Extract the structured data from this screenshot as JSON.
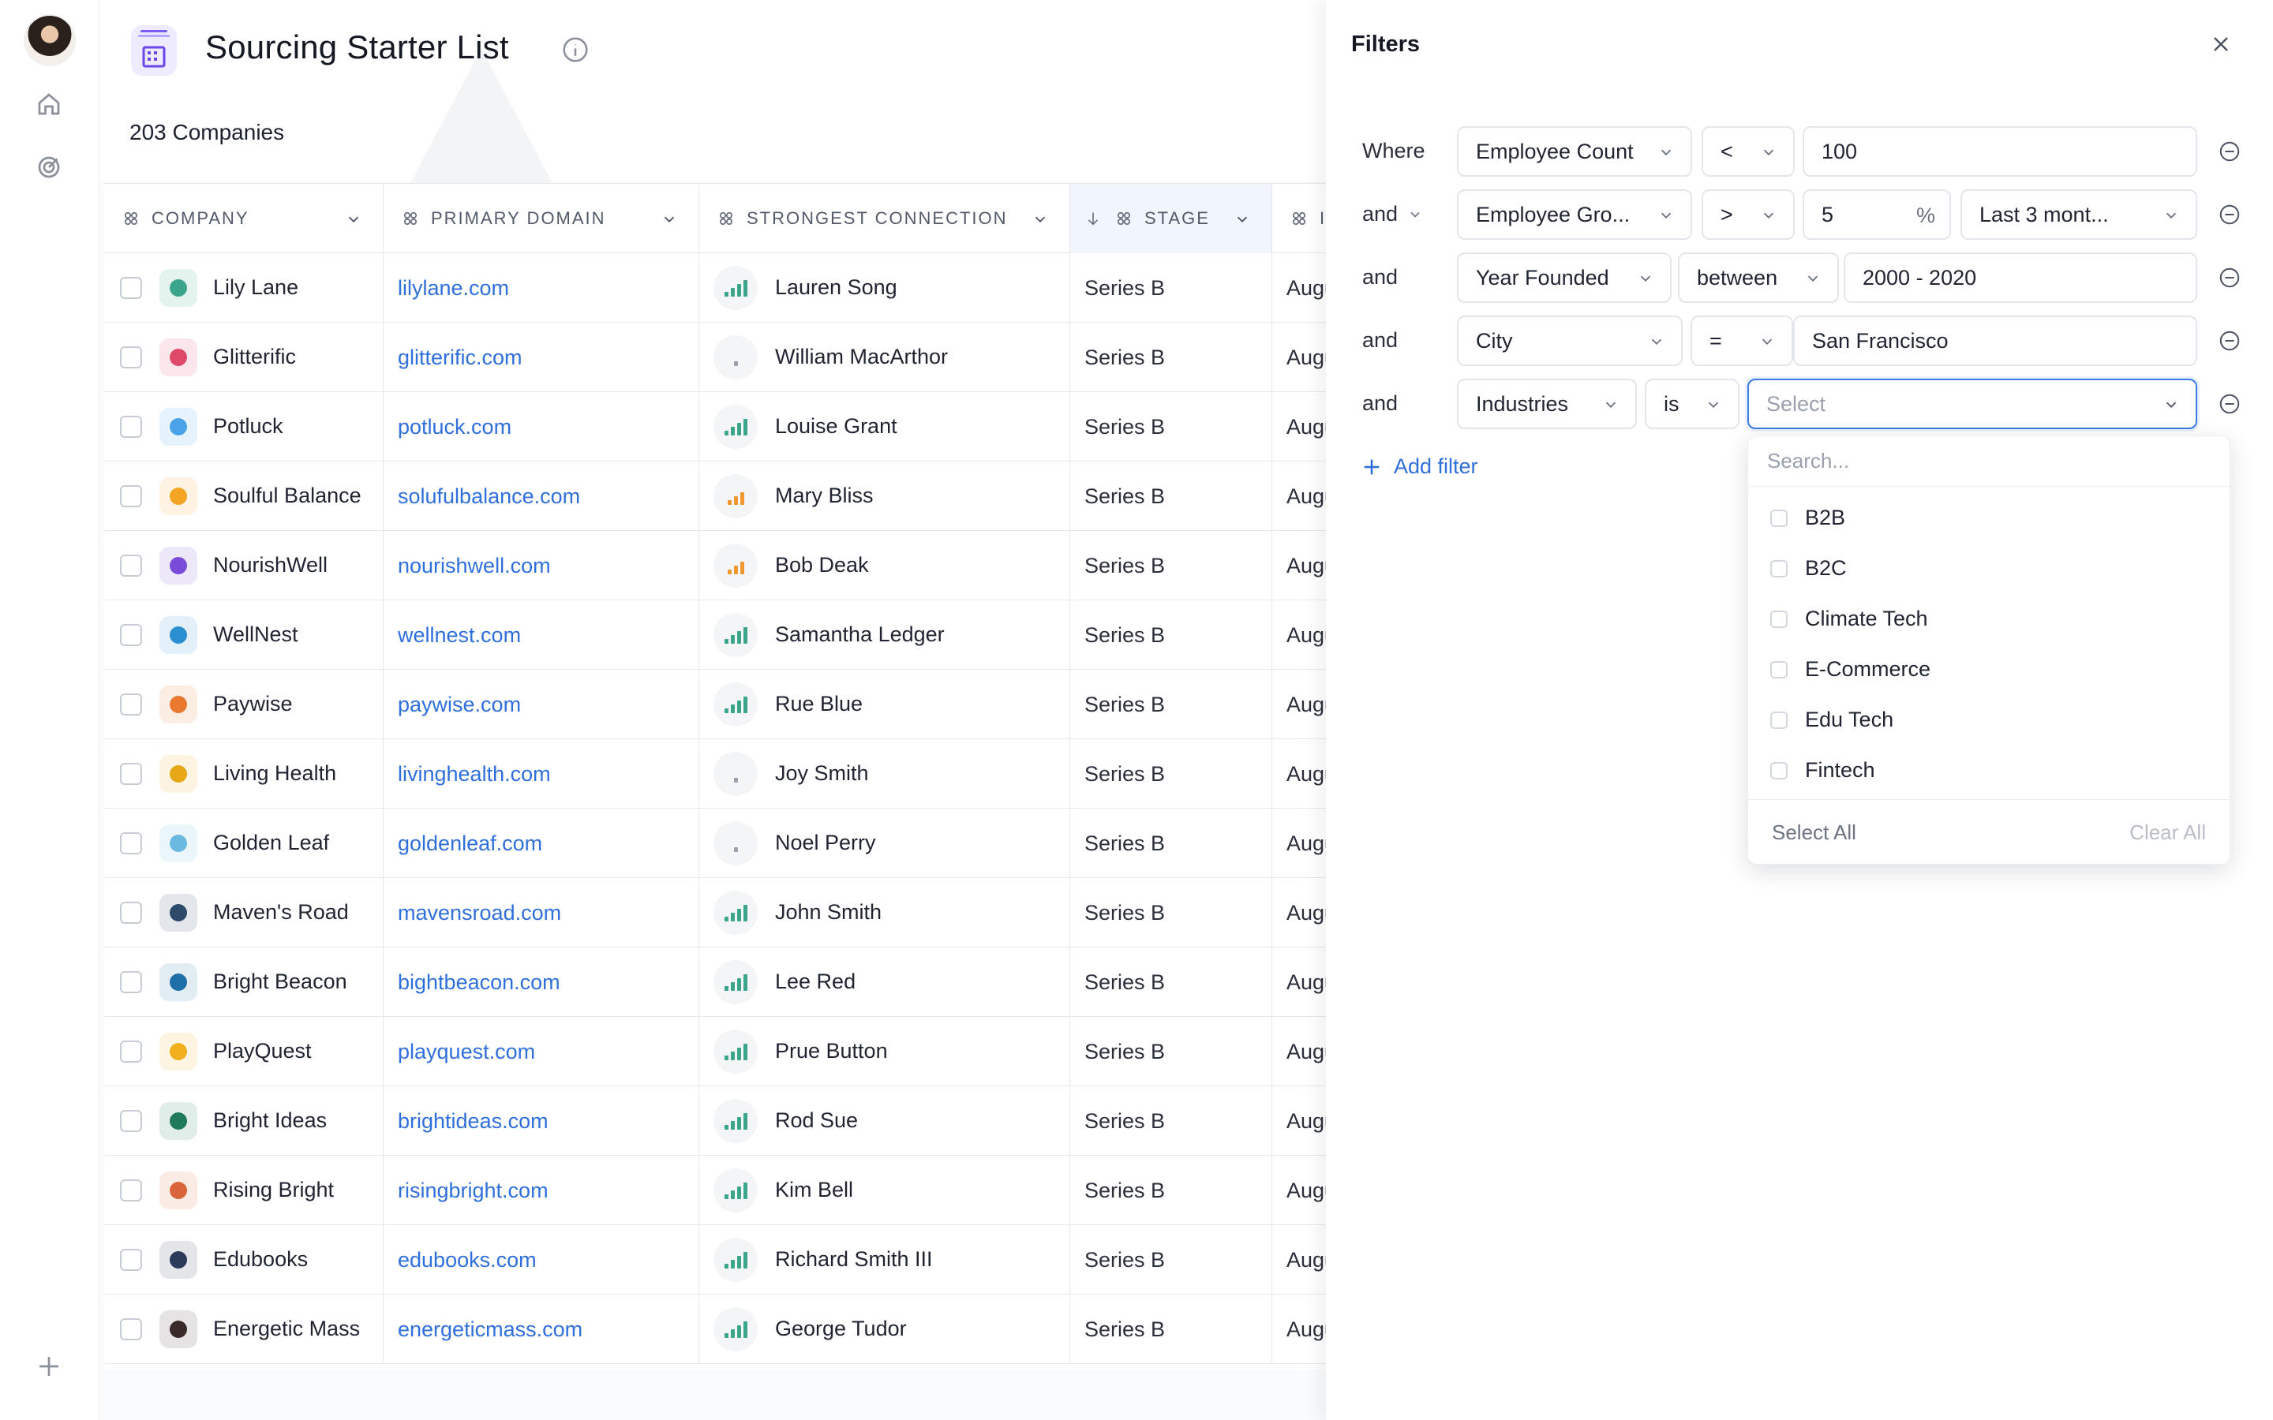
{
  "page": {
    "title": "Sourcing Starter List",
    "count": "203 Companies"
  },
  "columns": [
    {
      "key": "company",
      "label": "COMPANY"
    },
    {
      "key": "domain",
      "label": "PRIMARY DOMAIN"
    },
    {
      "key": "connection",
      "label": "STRONGEST CONNECTION"
    },
    {
      "key": "stage",
      "label": "STAGE"
    },
    {
      "key": "next",
      "label": "I"
    }
  ],
  "rows": [
    {
      "company": "Lily Lane",
      "domain": "lilylane.com",
      "connection": "Lauren Song",
      "strength": 4,
      "stage": "Series B",
      "next": "Augu",
      "color": "#3aa58a"
    },
    {
      "company": "Glitterific",
      "domain": "glitterific.com",
      "connection": "William MacArthor",
      "strength": 1,
      "stage": "Series B",
      "next": "Augu",
      "color": "#e04a6a"
    },
    {
      "company": "Potluck",
      "domain": "potluck.com",
      "connection": "Louise Grant",
      "strength": 4,
      "stage": "Series B",
      "next": "Augu",
      "color": "#4aa3e8"
    },
    {
      "company": "Soulful Balance",
      "domain": "solufulbalance.com",
      "connection": "Mary Bliss",
      "strength": 3,
      "stage": "Series B",
      "next": "Augu",
      "color": "#f5a524"
    },
    {
      "company": "NourishWell",
      "domain": "nourishwell.com",
      "connection": "Bob Deak",
      "strength": 3,
      "stage": "Series B",
      "next": "Augu",
      "color": "#7a4bd8"
    },
    {
      "company": "WellNest",
      "domain": "wellnest.com",
      "connection": "Samantha Ledger",
      "strength": 4,
      "stage": "Series B",
      "next": "Augu",
      "color": "#2a8fd0"
    },
    {
      "company": "Paywise",
      "domain": "paywise.com",
      "connection": "Rue Blue",
      "strength": 4,
      "stage": "Series B",
      "next": "Augu",
      "color": "#e8792e"
    },
    {
      "company": "Living Health",
      "domain": "livinghealth.com",
      "connection": "Joy Smith",
      "strength": 1,
      "stage": "Series B",
      "next": "Augu",
      "color": "#e6a817"
    },
    {
      "company": "Golden Leaf",
      "domain": "goldenleaf.com",
      "connection": "Noel Perry",
      "strength": 1,
      "stage": "Series B",
      "next": "Augu",
      "color": "#6bb8e0"
    },
    {
      "company": "Maven's Road",
      "domain": "mavensroad.com",
      "connection": "John Smith",
      "strength": 4,
      "stage": "Series B",
      "next": "Augu",
      "color": "#2d4a6a"
    },
    {
      "company": "Bright Beacon",
      "domain": "bightbeacon.com",
      "connection": "Lee Red",
      "strength": 4,
      "stage": "Series B",
      "next": "Augu",
      "color": "#1e6fa8"
    },
    {
      "company": "PlayQuest",
      "domain": "playquest.com",
      "connection": "Prue Button",
      "strength": 4,
      "stage": "Series B",
      "next": "Augu",
      "color": "#f2b01e"
    },
    {
      "company": "Bright Ideas",
      "domain": "brightideas.com",
      "connection": "Rod Sue",
      "strength": 4,
      "stage": "Series B",
      "next": "Augu",
      "color": "#1e7a5a"
    },
    {
      "company": "Rising Bright",
      "domain": "risingbright.com",
      "connection": "Kim Bell",
      "strength": 4,
      "stage": "Series B",
      "next": "Augu",
      "color": "#d8663a"
    },
    {
      "company": "Edubooks",
      "domain": "edubooks.com",
      "connection": "Richard Smith III",
      "strength": 4,
      "stage": "Series B",
      "next": "Augu",
      "color": "#2a3a5a"
    },
    {
      "company": "Energetic Mass",
      "domain": "energeticmass.com",
      "connection": "George Tudor",
      "strength": 4,
      "stage": "Series B",
      "next": "Augu",
      "color": "#3a2a2a"
    }
  ],
  "filters": {
    "title": "Filters",
    "rows": [
      {
        "conj": "Where",
        "field": "Employee Count",
        "op": "<",
        "value": "100"
      },
      {
        "conj": "and",
        "field": "Employee Gro...",
        "op": ">",
        "value": "5",
        "unit": "%",
        "period": "Last 3 mont..."
      },
      {
        "conj": "and",
        "field": "Year Founded",
        "op": "between",
        "value": "2000 - 2020"
      },
      {
        "conj": "and",
        "field": "City",
        "op": "=",
        "value": "San Francisco"
      },
      {
        "conj": "and",
        "field": "Industries",
        "op": "is",
        "placeholder": "Select"
      }
    ],
    "add_label": "Add filter",
    "dropdown": {
      "search_placeholder": "Search...",
      "options": [
        "B2B",
        "B2C",
        "Climate Tech",
        "E-Commerce",
        "Edu Tech",
        "Fintech"
      ],
      "select_all": "Select All",
      "clear_all": "Clear All"
    }
  },
  "colors": {
    "accent": "#2f6fdc",
    "signal_strong": "#3aa58a",
    "signal_medium": "#f0962e",
    "signal_weak": "#9aa1ad"
  }
}
